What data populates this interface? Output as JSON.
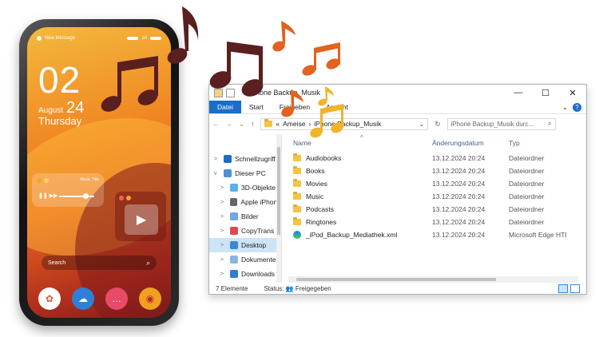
{
  "phone": {
    "status": {
      "notification": "New Message",
      "battery": "10"
    },
    "clock": {
      "hour": "02",
      "month": "August",
      "day": "24",
      "weekday": "Thursday"
    },
    "music_widget": {
      "title": "Music Title",
      "controls": "❚❚  ▶▶"
    },
    "video_widget": {
      "play": "▶"
    },
    "search": {
      "placeholder": "Search",
      "icon": "search-icon"
    },
    "dock": [
      "photos-app",
      "weather-app",
      "messages-app",
      "camera-app"
    ],
    "colors": {
      "screen_top": "#f4b93d",
      "screen_bottom": "#7b1c1a"
    }
  },
  "explorer": {
    "title": "iPhone Backup_Musik",
    "window_buttons": {
      "minimize": "—",
      "maximize": "☐",
      "close": "✕"
    },
    "ribbon": {
      "tabs": [
        "Datei",
        "Start",
        "Freigeben",
        "Ansicht"
      ],
      "help": "?"
    },
    "nav": {
      "back": "←",
      "forward": "→",
      "recent": "⌄",
      "up": "↑"
    },
    "address": {
      "prefix": "«",
      "crumbs": [
        "Ameise",
        "iPhone Backup_Musik"
      ],
      "separator": "›"
    },
    "search_placeholder": "iPhone Backup_Musik durc...",
    "sidebar": [
      {
        "label": "Schnellzugriff",
        "arrow": ">",
        "icon": "star-icon",
        "color": "#1a6ec7"
      },
      {
        "label": "Dieser PC",
        "arrow": "v",
        "icon": "computer-icon",
        "color": "#4a90d9"
      },
      {
        "label": "3D-Objekte",
        "arrow": ">",
        "icon": "cube-icon",
        "color": "#5bb0e8"
      },
      {
        "label": "Apple iPhone",
        "arrow": ">",
        "icon": "phone-icon",
        "color": "#666666"
      },
      {
        "label": "Bilder",
        "arrow": ">",
        "icon": "pictures-icon",
        "color": "#6fa8dc"
      },
      {
        "label": "CopyTrans S",
        "arrow": ">",
        "icon": "app-icon",
        "color": "#e04a4a"
      },
      {
        "label": "Desktop",
        "arrow": ">",
        "icon": "desktop-icon",
        "color": "#3d86d6",
        "selected": true
      },
      {
        "label": "Dokumente",
        "arrow": ">",
        "icon": "documents-icon",
        "color": "#8ab4e0"
      },
      {
        "label": "Downloads",
        "arrow": ">",
        "icon": "download-icon",
        "color": "#2f7fd0"
      }
    ],
    "columns": {
      "name": "Name",
      "date": "Änderungsdatum",
      "type": "Typ",
      "sort": "^"
    },
    "files": [
      {
        "name": "Audiobooks",
        "date": "13.12.2024 20:24",
        "type": "Dateiordner",
        "icon": "folder-icon"
      },
      {
        "name": "Books",
        "date": "13.12.2024 20:24",
        "type": "Dateiordner",
        "icon": "folder-icon"
      },
      {
        "name": "Movies",
        "date": "13.12.2024 20:24",
        "type": "Dateiordner",
        "icon": "folder-icon"
      },
      {
        "name": "Music",
        "date": "13.12.2024 20:24",
        "type": "Dateiordner",
        "icon": "folder-icon"
      },
      {
        "name": "Podcasts",
        "date": "13.12.2024 20:24",
        "type": "Dateiordner",
        "icon": "folder-icon"
      },
      {
        "name": "Ringtones",
        "date": "13.12.2024 20:24",
        "type": "Dateiordner",
        "icon": "folder-icon"
      },
      {
        "name": "_iPod_Backup_Mediathek.xml",
        "date": "13.12.2024 20:24",
        "type": "Microsoft Edge HTI",
        "icon": "edge-icon"
      }
    ],
    "status": {
      "count": "7 Elemente",
      "state_label": "Status:",
      "state_value": "Freigegeben"
    },
    "colors": {
      "accent": "#1a6ec7",
      "selection": "#cce4f7",
      "folder": "#f3c445"
    }
  },
  "notes": {
    "colors": [
      "#5a1f1f",
      "#e2621f",
      "#f0b429"
    ]
  }
}
